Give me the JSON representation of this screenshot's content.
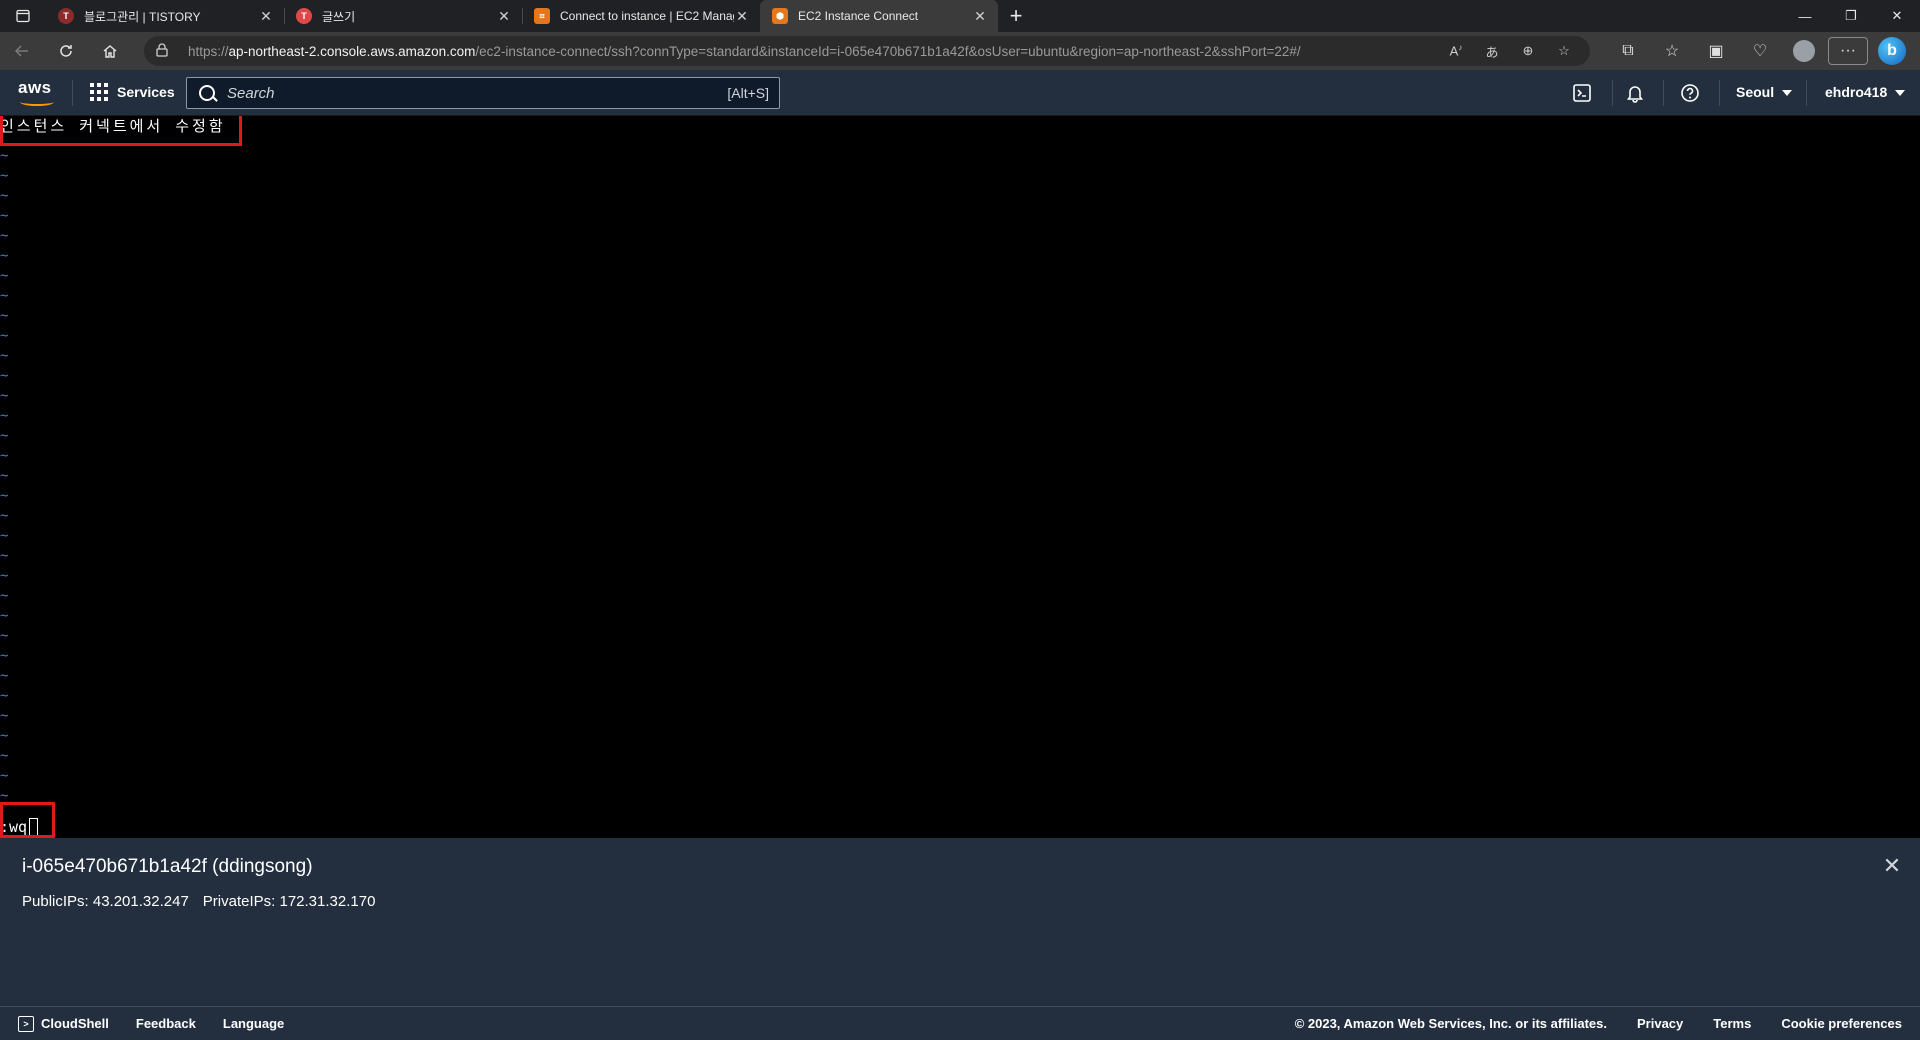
{
  "browser": {
    "tabs": [
      {
        "title": "블로그관리 | TISTORY",
        "favicon_color": "#8b2b2b"
      },
      {
        "title": "글쓰기",
        "favicon_color": "#e04848"
      },
      {
        "title": "Connect to instance | EC2 Management Console",
        "favicon_color": "#e4761b"
      },
      {
        "title": "EC2 Instance Connect",
        "favicon_color": "#e4761b"
      }
    ],
    "url_prefix": "https://",
    "url_host": "ap-northeast-2.console.aws.amazon.com",
    "url_path": "/ec2-instance-connect/ssh?connType=standard&instanceId=i-065e470b671b1a42f&osUser=ubuntu&region=ap-northeast-2&sshPort=22#/"
  },
  "aws_header": {
    "logo_text": "aws",
    "services_label": "Services",
    "search_placeholder": "Search",
    "search_shortcut": "[Alt+S]",
    "region": "Seoul",
    "account": "ehdro418"
  },
  "terminal": {
    "first_line": "인스턴스 커넥트에서 수정함",
    "tilde": "~",
    "tilde_count": 33,
    "command": ":wq"
  },
  "instance": {
    "title": "i-065e470b671b1a42f (ddingsong)",
    "public_ips": "PublicIPs: 43.201.32.247",
    "private_ips": "PrivateIPs: 172.31.32.170"
  },
  "footer": {
    "cloudshell": "CloudShell",
    "feedback": "Feedback",
    "language": "Language",
    "copyright": "© 2023, Amazon Web Services, Inc. or its affiliates.",
    "privacy": "Privacy",
    "terms": "Terms",
    "cookie_preferences": "Cookie preferences"
  },
  "colors": {
    "aws_nav": "#232f3e",
    "highlight_box": "#e11919",
    "tilde": "#2f7dff"
  }
}
